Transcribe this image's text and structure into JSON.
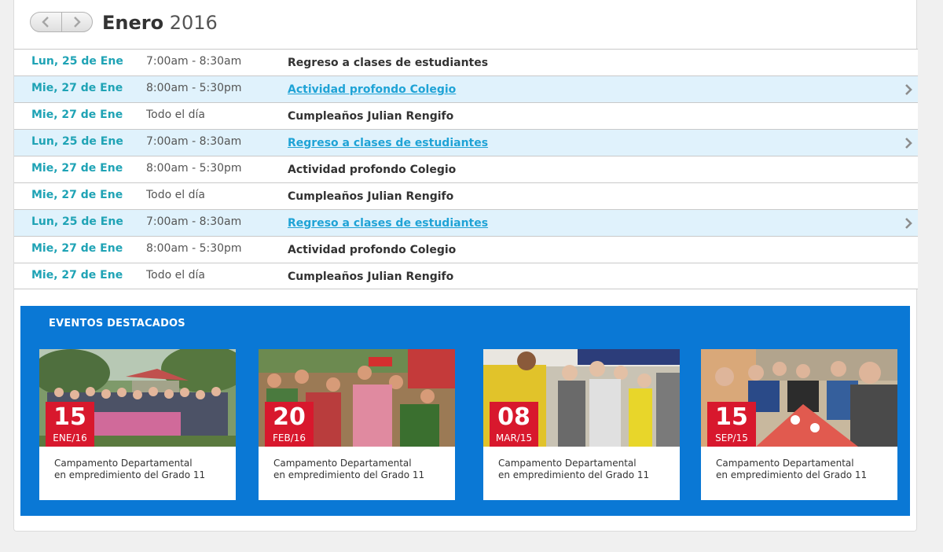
{
  "calendar": {
    "month": "Enero",
    "year": "2016",
    "prev_icon": "chevron-left-icon",
    "next_icon": "chevron-right-icon"
  },
  "events": [
    {
      "date": "Lun, 25 de Ene",
      "time": "7:00am - 8:30am",
      "name": "Regreso a clases de estudiantes",
      "highlighted": false
    },
    {
      "date": "Mie, 27 de Ene",
      "time": "8:00am - 5:30pm",
      "name": "Actividad profondo Colegio",
      "highlighted": true
    },
    {
      "date": "Mie, 27 de Ene",
      "time": "Todo el día",
      "name": "Cumpleaños Julian Rengifo",
      "highlighted": false
    },
    {
      "date": "Lun, 25 de Ene",
      "time": "7:00am - 8:30am",
      "name": "Regreso a clases de estudiantes",
      "highlighted": true
    },
    {
      "date": "Mie, 27 de Ene",
      "time": "8:00am - 5:30pm",
      "name": "Actividad profondo Colegio",
      "highlighted": false
    },
    {
      "date": "Mie, 27 de Ene",
      "time": "Todo el día",
      "name": "Cumpleaños Julian Rengifo",
      "highlighted": false
    },
    {
      "date": "Lun, 25 de Ene",
      "time": "7:00am - 8:30am",
      "name": "Regreso a clases de estudiantes",
      "highlighted": true
    },
    {
      "date": "Mie, 27 de Ene",
      "time": "8:00am - 5:30pm",
      "name": "Actividad profondo Colegio",
      "highlighted": false
    },
    {
      "date": "Mie, 27 de Ene",
      "time": "Todo el día",
      "name": "Cumpleaños Julian Rengifo",
      "highlighted": false
    }
  ],
  "featured": {
    "title": "EVENTOS DESTACADOS",
    "cards": [
      {
        "day": "15",
        "month": "ENE/16",
        "line1": "Campamento Departamental",
        "line2": "en empredimiento del Grado 11"
      },
      {
        "day": "20",
        "month": "FEB/16",
        "line1": "Campamento Departamental",
        "line2": "en empredimiento del Grado 11"
      },
      {
        "day": "08",
        "month": "MAR/15",
        "line1": "Campamento Departamental",
        "line2": "en empredimiento del Grado 11"
      },
      {
        "day": "15",
        "month": "SEP/15",
        "line1": "Campamento Departamental",
        "line2": "en empredimiento del Grado 11"
      }
    ]
  },
  "colors": {
    "date_teal": "#1fa3b5",
    "link_blue": "#1fa3d6",
    "row_highlight": "#e0f2fc",
    "featured_bg": "#0a78d5",
    "badge_red": "#d8182d"
  }
}
